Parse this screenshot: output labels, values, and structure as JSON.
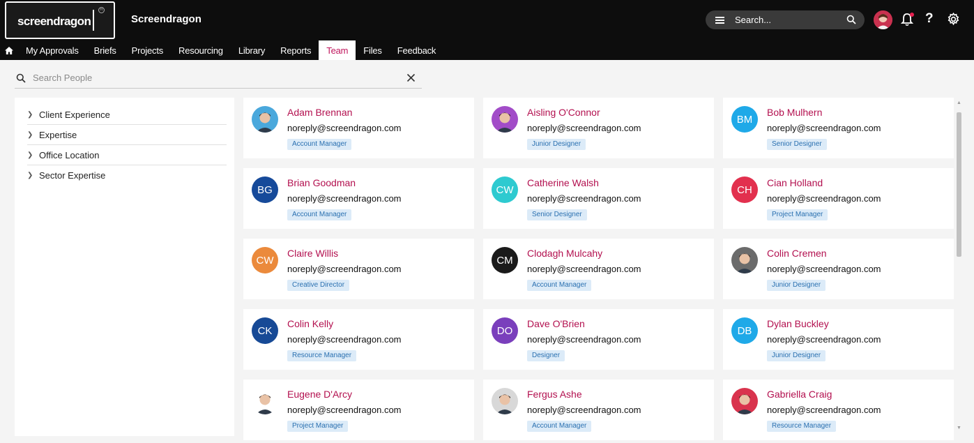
{
  "header": {
    "logo_text": "screendragon",
    "app_title": "Screendragon",
    "search_placeholder": "Search...",
    "help_label": "?"
  },
  "nav": {
    "items": [
      {
        "label": "My Approvals"
      },
      {
        "label": "Briefs"
      },
      {
        "label": "Projects"
      },
      {
        "label": "Resourcing"
      },
      {
        "label": "Library"
      },
      {
        "label": "Reports"
      },
      {
        "label": "Team",
        "active": true
      },
      {
        "label": "Files"
      },
      {
        "label": "Feedback"
      }
    ]
  },
  "people_search": {
    "placeholder": "Search People",
    "value": ""
  },
  "filters": [
    {
      "label": "Client Experience"
    },
    {
      "label": "Expertise"
    },
    {
      "label": "Office Location"
    },
    {
      "label": "Sector Expertise"
    }
  ],
  "people": [
    {
      "name": "Adam Brennan",
      "email": "noreply@screendragon.com",
      "role": "Account Manager",
      "initials": "",
      "avatar": "photo",
      "color": "#4aa8dc"
    },
    {
      "name": "Aisling O'Connor",
      "email": "noreply@screendragon.com",
      "role": "Junior Designer",
      "initials": "",
      "avatar": "photo",
      "color": "#a24cc8"
    },
    {
      "name": "Bob Mulhern",
      "email": "noreply@screendragon.com",
      "role": "Senior Designer",
      "initials": "BM",
      "avatar": "initials",
      "color": "#1fa9e8"
    },
    {
      "name": "Brian Goodman",
      "email": "noreply@screendragon.com",
      "role": "Account Manager",
      "initials": "BG",
      "avatar": "initials",
      "color": "#164a9a"
    },
    {
      "name": "Catherine Walsh",
      "email": "noreply@screendragon.com",
      "role": "Senior Designer",
      "initials": "CW",
      "avatar": "initials",
      "color": "#2ecad0"
    },
    {
      "name": "Cian Holland",
      "email": "noreply@screendragon.com",
      "role": "Project Manager",
      "initials": "CH",
      "avatar": "initials",
      "color": "#e2304e"
    },
    {
      "name": "Claire Willis",
      "email": "noreply@screendragon.com",
      "role": "Creative Director",
      "initials": "CW",
      "avatar": "initials",
      "color": "#eb8a3c"
    },
    {
      "name": "Clodagh Mulcahy",
      "email": "noreply@screendragon.com",
      "role": "Account Manager",
      "initials": "CM",
      "avatar": "initials",
      "color": "#1a1a1a"
    },
    {
      "name": "Colin Cremen",
      "email": "noreply@screendragon.com",
      "role": "Junior Designer",
      "initials": "",
      "avatar": "photo",
      "color": "#6b6b6b"
    },
    {
      "name": "Colin Kelly",
      "email": "noreply@screendragon.com",
      "role": "Resource Manager",
      "initials": "CK",
      "avatar": "initials",
      "color": "#174a96"
    },
    {
      "name": "Dave O'Brien",
      "email": "noreply@screendragon.com",
      "role": "Designer",
      "initials": "DO",
      "avatar": "initials",
      "color": "#7a3fbc"
    },
    {
      "name": "Dylan Buckley",
      "email": "noreply@screendragon.com",
      "role": "Junior Designer",
      "initials": "DB",
      "avatar": "initials",
      "color": "#1fa9e8"
    },
    {
      "name": "Eugene D'Arcy",
      "email": "noreply@screendragon.com",
      "role": "Project Manager",
      "initials": "",
      "avatar": "photo",
      "color": "#ffffff"
    },
    {
      "name": "Fergus Ashe",
      "email": "noreply@screendragon.com",
      "role": "Account Manager",
      "initials": "",
      "avatar": "photo",
      "color": "#d8d8d8"
    },
    {
      "name": "Gabriella Craig",
      "email": "noreply@screendragon.com",
      "role": "Resource Manager",
      "initials": "",
      "avatar": "photo",
      "color": "#d9334d"
    }
  ]
}
